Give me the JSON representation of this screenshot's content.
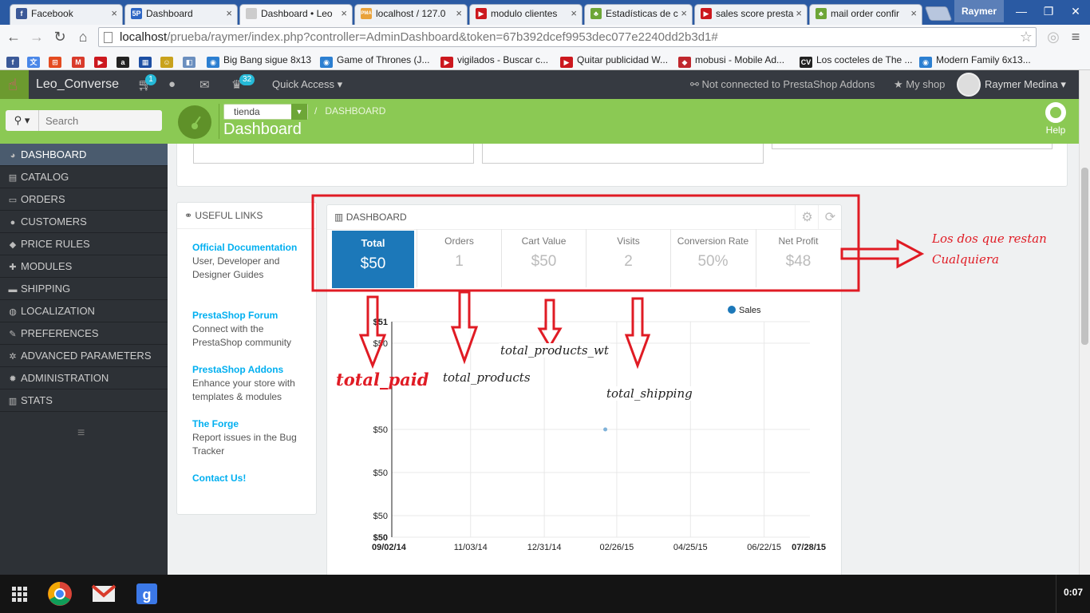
{
  "browser": {
    "tabs": [
      {
        "title": "Facebook",
        "icon": "facebook-icon",
        "color": "#3b5998",
        "glyph": "f"
      },
      {
        "title": "Dashboard",
        "icon": "prestashop-icon",
        "color": "#2e66c4",
        "glyph": "5P"
      },
      {
        "title": "Dashboard • Leo",
        "icon": "loading-icon",
        "color": "#cccccc",
        "glyph": ""
      },
      {
        "title": "localhost / 127.0",
        "icon": "phpmyadmin-icon",
        "color": "#e9a23a",
        "glyph": "PMA"
      },
      {
        "title": "modulo clientes",
        "icon": "youtube-icon",
        "color": "#cc181e",
        "glyph": "▶"
      },
      {
        "title": "Estadísticas de c",
        "icon": "prestashop-forum-icon",
        "color": "#6da637",
        "glyph": "♣"
      },
      {
        "title": "sales score presta",
        "icon": "youtube-icon",
        "color": "#cc181e",
        "glyph": "▶"
      },
      {
        "title": "mail order confir",
        "icon": "prestashop-forum-icon",
        "color": "#6da637",
        "glyph": "♣"
      }
    ],
    "profile_name": "Raymer",
    "url_host": "localhost",
    "url_path": "/prueba/raymer/index.php?controller=AdminDashboard&token=67b392dcef9953dec077e2240dd2b3d1#",
    "bookmarks": [
      {
        "label": "",
        "icon": "facebook-icon",
        "color": "#3b5998",
        "glyph": "f"
      },
      {
        "label": "",
        "icon": "translate-icon",
        "color": "#4a87e8",
        "glyph": "文"
      },
      {
        "label": "",
        "icon": "windows-icon",
        "color": "#e44b20",
        "glyph": "⊞"
      },
      {
        "label": "",
        "icon": "gmail-icon",
        "color": "#d93b2b",
        "glyph": "M"
      },
      {
        "label": "",
        "icon": "youtube-icon",
        "color": "#cc181e",
        "glyph": "▶"
      },
      {
        "label": "",
        "icon": "amazon-icon",
        "color": "#222222",
        "glyph": "a"
      },
      {
        "label": "",
        "icon": "store-icon",
        "color": "#1d4fa3",
        "glyph": "▦"
      },
      {
        "label": "",
        "icon": "smiley-icon",
        "color": "#c9a21c",
        "glyph": "☺"
      },
      {
        "label": "",
        "icon": "photo-icon",
        "color": "#6b8fbf",
        "glyph": "◧"
      },
      {
        "label": "Big Bang  sigue 8x13",
        "icon": "series-icon",
        "color": "#2c7fd1",
        "glyph": "◉"
      },
      {
        "label": "Game of Thrones (J...",
        "icon": "series-icon",
        "color": "#2c7fd1",
        "glyph": "◉"
      },
      {
        "label": "vigilados - Buscar c...",
        "icon": "youtube-icon",
        "color": "#cc181e",
        "glyph": "▶"
      },
      {
        "label": "Quitar publicidad W...",
        "icon": "youtube-icon",
        "color": "#cc181e",
        "glyph": "▶"
      },
      {
        "label": "mobusi - Mobile Ad...",
        "icon": "mobusi-icon",
        "color": "#c0272d",
        "glyph": "◆"
      },
      {
        "label": "Los cocteles de The ...",
        "icon": "cv-icon",
        "color": "#222222",
        "glyph": "CV"
      },
      {
        "label": "Modern Family 6x13...",
        "icon": "series-icon",
        "color": "#2c7fd1",
        "glyph": "◉"
      }
    ]
  },
  "header": {
    "shop_name": "Leo_Converse",
    "cart_badge": "1",
    "trophy_badge": "32",
    "quick_access": "Quick Access",
    "addons_status": "Not connected to PrestaShop Addons",
    "my_shop": "My shop",
    "user_name": "Raymer Medina"
  },
  "sidebar": {
    "search_placeholder": "Search",
    "items": [
      {
        "label": "DASHBOARD",
        "icon": "dashboard-icon",
        "glyph": "◕",
        "active": true
      },
      {
        "label": "CATALOG",
        "icon": "book-icon",
        "glyph": "▤",
        "active": false
      },
      {
        "label": "ORDERS",
        "icon": "credit-card-icon",
        "glyph": "▭",
        "active": false
      },
      {
        "label": "CUSTOMERS",
        "icon": "users-icon",
        "glyph": "●",
        "active": false
      },
      {
        "label": "PRICE RULES",
        "icon": "tag-icon",
        "glyph": "◆",
        "active": false
      },
      {
        "label": "MODULES",
        "icon": "puzzle-icon",
        "glyph": "✚",
        "active": false
      },
      {
        "label": "SHIPPING",
        "icon": "truck-icon",
        "glyph": "▬",
        "active": false
      },
      {
        "label": "LOCALIZATION",
        "icon": "globe-icon",
        "glyph": "◍",
        "active": false
      },
      {
        "label": "PREFERENCES",
        "icon": "wrench-icon",
        "glyph": "✎",
        "active": false
      },
      {
        "label": "ADVANCED PARAMETERS",
        "icon": "cogs-icon",
        "glyph": "✲",
        "active": false
      },
      {
        "label": "ADMINISTRATION",
        "icon": "gear-icon",
        "glyph": "✹",
        "active": false
      },
      {
        "label": "STATS",
        "icon": "bar-chart-icon",
        "glyph": "▥",
        "active": false
      }
    ]
  },
  "pagebar": {
    "shop_select": "tienda",
    "breadcrumb": "DASHBOARD",
    "title": "Dashboard",
    "help": "Help"
  },
  "useful_links": {
    "heading": "USEFUL LINKS",
    "items": [
      {
        "title": "Official Documentation",
        "desc": "User, Developer and Designer Guides"
      },
      {
        "title": "PrestaShop Forum",
        "desc": "Connect with the PrestaShop community"
      },
      {
        "title": "PrestaShop Addons",
        "desc": "Enhance your store with templates & modules"
      },
      {
        "title": "The Forge",
        "desc": "Report issues in the Bug Tracker"
      },
      {
        "title": "Contact Us!",
        "desc": ""
      }
    ]
  },
  "dashboard": {
    "heading": "DASHBOARD",
    "kpis": [
      {
        "label": "Total",
        "value": "$50",
        "active": true
      },
      {
        "label": "Orders",
        "value": "1",
        "active": false
      },
      {
        "label": "Cart Value",
        "value": "$50",
        "active": false
      },
      {
        "label": "Visits",
        "value": "2",
        "active": false
      },
      {
        "label": "Conversion Rate",
        "value": "50%",
        "active": false
      },
      {
        "label": "Net Profit",
        "value": "$48",
        "active": false
      }
    ]
  },
  "chart_data": {
    "type": "scatter",
    "title": "",
    "legend": [
      "Sales"
    ],
    "legend_position": "top-right",
    "x_tick_labels": [
      "09/02/14",
      "11/03/14",
      "12/31/14",
      "02/26/15",
      "04/25/15",
      "06/22/15",
      "07/28/15"
    ],
    "y_tick_labels": [
      "$51",
      "$50",
      "$50",
      "$50",
      "$50",
      "$50"
    ],
    "series": [
      {
        "name": "Sales",
        "x": [
          "02/17/15"
        ],
        "y": [
          50
        ]
      }
    ],
    "grid": true,
    "color": "#1c78b9"
  },
  "annotations": {
    "note_line1": "Los dos que restan",
    "note_line2": "Cualquiera",
    "total_paid": "total_paid",
    "total_products": "total_products",
    "total_products_wt": "total_products_wt",
    "total_shipping": "total_shipping",
    "color": "#e01b24"
  },
  "taskbar": {
    "clock": "0:07"
  }
}
